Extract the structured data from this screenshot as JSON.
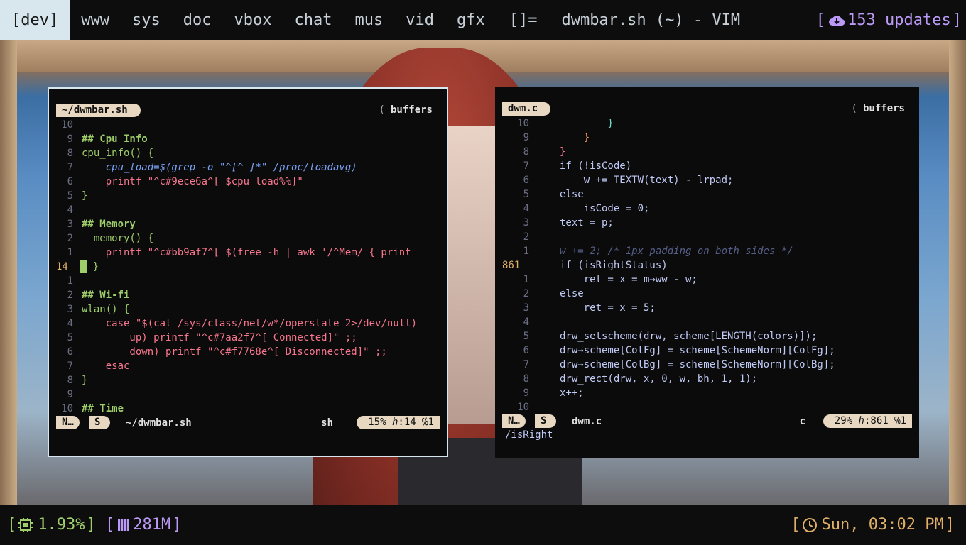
{
  "topbar": {
    "tags": [
      "[dev]",
      "www",
      "sys",
      "doc",
      "vbox",
      "chat",
      "mus",
      "vid",
      "gfx"
    ],
    "layout_symbol": "[]=",
    "window_title": "dwmbar.sh (~) - VIM",
    "updates": "153 updates",
    "accent_color": "#bb9af7"
  },
  "left_term": {
    "tab_name": "~/dwmbar.sh",
    "buffers_label": "buffers",
    "lines": [
      {
        "n": "10",
        "text": ""
      },
      {
        "n": "9",
        "text": "## Cpu Info"
      },
      {
        "n": "8",
        "text": "cpu_info() {"
      },
      {
        "n": "7",
        "text": "    cpu_load=$(grep -o \"^[^ ]*\" /proc/loadavg)"
      },
      {
        "n": "6",
        "text": "    printf \"^c#9ece6a^[ $cpu_load%%]\""
      },
      {
        "n": "5",
        "text": "}"
      },
      {
        "n": "4",
        "text": ""
      },
      {
        "n": "3",
        "text": "## Memory"
      },
      {
        "n": "2",
        "text": "  memory() {"
      },
      {
        "n": "1",
        "text": "    printf \"^c#bb9af7^[ $(free -h | awk '/^Mem/ { print"
      },
      {
        "n": "14",
        "text": "}"
      },
      {
        "n": "1",
        "text": ""
      },
      {
        "n": "2",
        "text": "## Wi-fi"
      },
      {
        "n": "3",
        "text": "wlan() {"
      },
      {
        "n": "4",
        "text": "    case \"$(cat /sys/class/net/w*/operstate 2>/dev/null)"
      },
      {
        "n": "5",
        "text": "        up) printf \"^c#7aa2f7^[ Connected]\" ;;"
      },
      {
        "n": "6",
        "text": "        down) printf \"^c#f7768e^[ Disconnected]\" ;;"
      },
      {
        "n": "7",
        "text": "    esac"
      },
      {
        "n": "8",
        "text": "}"
      },
      {
        "n": "9",
        "text": ""
      },
      {
        "n": "10",
        "text": "## Time"
      }
    ],
    "status": {
      "mode": "N…",
      "s": "S",
      "file": "~/dwmbar.sh",
      "filetype": "sh",
      "percent": "15%",
      "line": "14",
      "col": "1"
    }
  },
  "right_term": {
    "tab_name": "dwm.c",
    "buffers_label": "buffers",
    "lines": [
      {
        "n": "10",
        "text": "        }"
      },
      {
        "n": "9",
        "text": "    }"
      },
      {
        "n": "8",
        "text": "}"
      },
      {
        "n": "7",
        "text": "if (!isCode)"
      },
      {
        "n": "6",
        "text": "    w += TEXTW(text) - lrpad;"
      },
      {
        "n": "5",
        "text": "else"
      },
      {
        "n": "4",
        "text": "    isCode = 0;"
      },
      {
        "n": "3",
        "text": "text = p;"
      },
      {
        "n": "2",
        "text": ""
      },
      {
        "n": "1",
        "text": "w += 2; /* 1px padding on both sides */"
      },
      {
        "n": "861",
        "text": "if (isRightStatus)"
      },
      {
        "n": "1",
        "text": "    ret = x = m→ww - w;"
      },
      {
        "n": "2",
        "text": "else"
      },
      {
        "n": "3",
        "text": "    ret = x = 5;"
      },
      {
        "n": "4",
        "text": ""
      },
      {
        "n": "5",
        "text": "drw_setscheme(drw, scheme[LENGTH(colors)]);"
      },
      {
        "n": "6",
        "text": "drw→scheme[ColFg] = scheme[SchemeNorm][ColFg];"
      },
      {
        "n": "7",
        "text": "drw→scheme[ColBg] = scheme[SchemeNorm][ColBg];"
      },
      {
        "n": "8",
        "text": "drw_rect(drw, x, 0, w, bh, 1, 1);"
      },
      {
        "n": "9",
        "text": "x++;"
      },
      {
        "n": "10",
        "text": ""
      }
    ],
    "status": {
      "mode": "N…",
      "s": "S",
      "file": "dwm.c",
      "filetype": "c",
      "percent": "29%",
      "line": "861",
      "col": "1"
    },
    "cmdline": "/isRight"
  },
  "bottombar": {
    "cpu": "1.93%",
    "mem": "281M",
    "clock": "Sun, 03:02 PM"
  }
}
